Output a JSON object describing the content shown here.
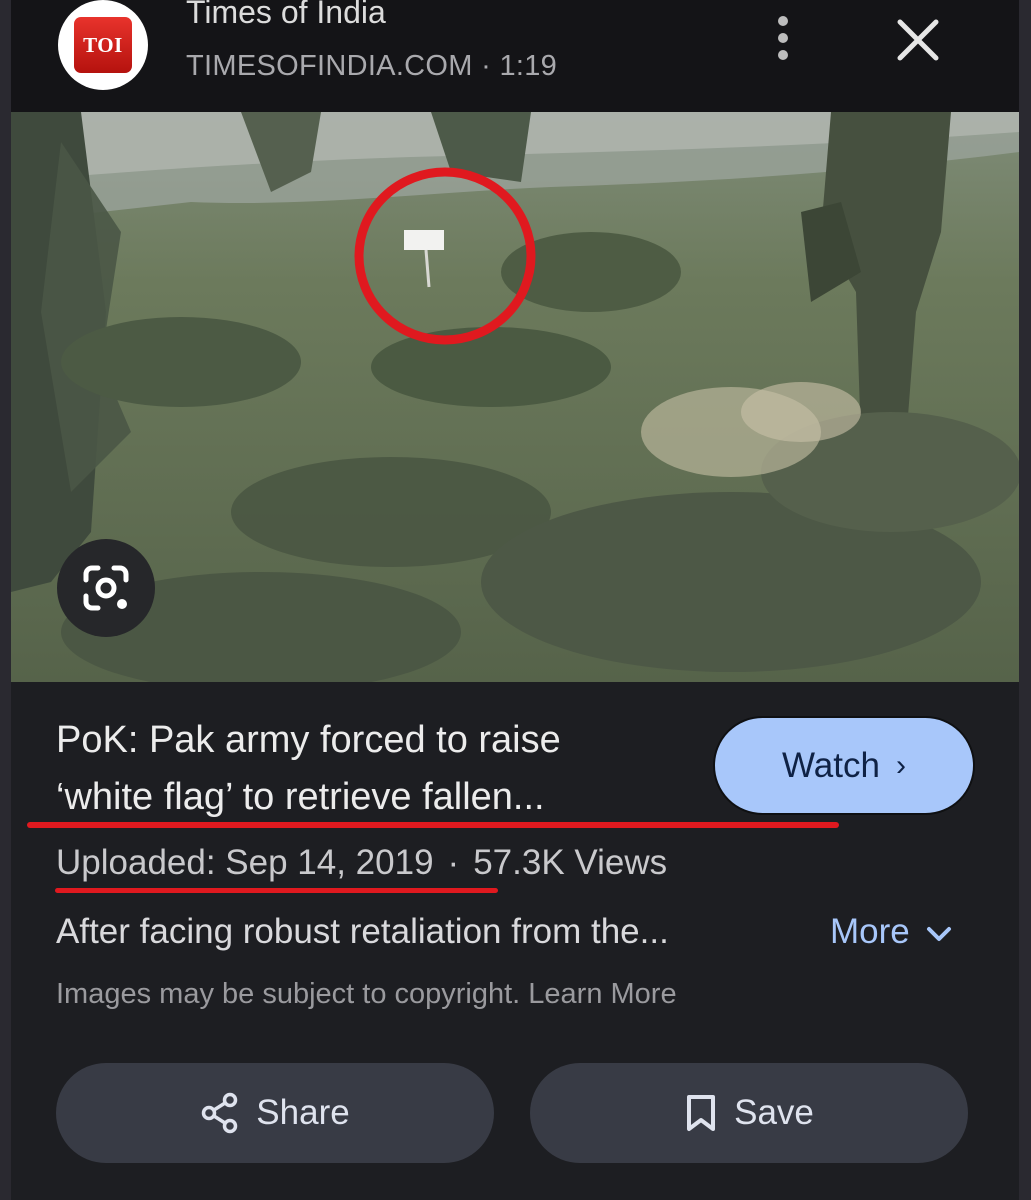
{
  "header": {
    "logo_text": "TOI",
    "source_name": "Times of India",
    "source_domain": "TIMESOFINDIA.COM",
    "meta_separator": "·",
    "duration": "1:19"
  },
  "result": {
    "title_line1": "PoK: Pak army forced to raise",
    "title_line2": "‘white flag’ to retrieve fallen...",
    "watch_label": "Watch",
    "watch_chevron": "›",
    "uploaded": "Uploaded: Sep 14, 2019",
    "separator": "·",
    "views": "57.3K Views",
    "description": "After facing robust retaliation from the...",
    "more_label": "More",
    "more_chevron": "⌄",
    "copyright_text": "Images may be subject to copyright.",
    "learn_more": "Learn More"
  },
  "actions": {
    "share_label": "Share",
    "save_label": "Save"
  },
  "icons": {
    "menu": "more-vert-icon",
    "close": "close-icon",
    "lens": "google-lens-icon",
    "share": "share-icon",
    "save": "bookmark-icon"
  },
  "colors": {
    "accent": "#a8c7fa",
    "annotation_red": "#e0191f",
    "background": "#1d1e22",
    "brand_red": "#d3211b"
  }
}
